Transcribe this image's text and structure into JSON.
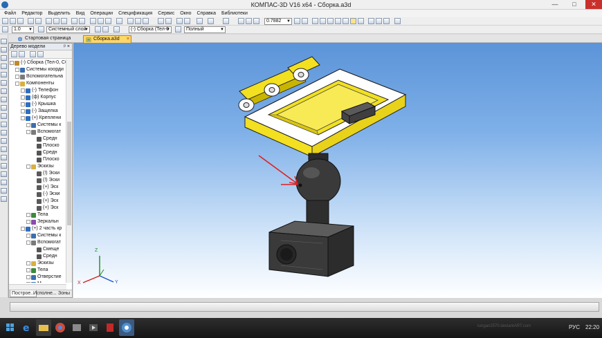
{
  "window": {
    "title": "КОМПАС-3D V16  x64 - Сборка.a3d",
    "min": "—",
    "max": "□",
    "close": "✕"
  },
  "menu": [
    "Файл",
    "Редактор",
    "Выделить",
    "Вид",
    "Операции",
    "Спецификация",
    "Сервис",
    "Окно",
    "Справка",
    "Библиотеки"
  ],
  "toolbar": {
    "scale_combo": "1.0",
    "layer_combo": "Системный слой",
    "assembly_combo": "(-) Сборка (Тел-0",
    "mode_combo": "Полный",
    "zoom_combo": "0.7882"
  },
  "tabs": [
    {
      "label": "Стартовая страница",
      "icon": "globe-icon"
    },
    {
      "label": "Сборка.a3d",
      "icon": "assembly-icon",
      "close": "×"
    }
  ],
  "tree": {
    "header": "Дерево модели",
    "pin": "ᵖ",
    "close": "×",
    "nodes": [
      {
        "label": "(-) Сборка (Тел-0, Сб",
        "indent": 0,
        "icon": "assembly-icon"
      },
      {
        "label": "Системы коорди",
        "indent": 1,
        "icon": "axes-icon"
      },
      {
        "label": "Вспомогательна",
        "indent": 1,
        "icon": "aux-geometry-icon"
      },
      {
        "label": "Компоненты",
        "indent": 1,
        "icon": "folder-icon"
      },
      {
        "label": "(-) Телефон",
        "indent": 2,
        "icon": "part-icon"
      },
      {
        "label": "(ф) Корпус",
        "indent": 2,
        "icon": "part-icon"
      },
      {
        "label": "(-) Крышка",
        "indent": 2,
        "icon": "part-icon"
      },
      {
        "label": "(-) Защелка",
        "indent": 2,
        "icon": "part-icon"
      },
      {
        "label": "(+) Креплени",
        "indent": 2,
        "icon": "part-icon"
      },
      {
        "label": "Системы к",
        "indent": 3,
        "icon": "axes-icon"
      },
      {
        "label": "Вспомогат",
        "indent": 3,
        "icon": "aux-geometry-icon"
      },
      {
        "label": "Средн",
        "indent": 4,
        "icon": "plane-icon"
      },
      {
        "label": "Плоско",
        "indent": 4,
        "icon": "plane-icon"
      },
      {
        "label": "Средн",
        "indent": 4,
        "icon": "plane-icon"
      },
      {
        "label": "Плоско",
        "indent": 4,
        "icon": "plane-icon"
      },
      {
        "label": "Эскизы",
        "indent": 3,
        "icon": "folder-icon"
      },
      {
        "label": "(!) Эски",
        "indent": 4,
        "icon": "sketch-icon"
      },
      {
        "label": "(!) Эски",
        "indent": 4,
        "icon": "sketch-icon"
      },
      {
        "label": "(+) Эск",
        "indent": 4,
        "icon": "sketch-icon"
      },
      {
        "label": "(-) Эски",
        "indent": 4,
        "icon": "sketch-icon"
      },
      {
        "label": "(+) Эск",
        "indent": 4,
        "icon": "sketch-icon"
      },
      {
        "label": "(+) Эск",
        "indent": 4,
        "icon": "sketch-icon"
      },
      {
        "label": "Тела",
        "indent": 3,
        "icon": "body-icon"
      },
      {
        "label": "Зеркальн",
        "indent": 3,
        "icon": "mirror-icon"
      },
      {
        "label": "(+) 2 часть кр",
        "indent": 2,
        "icon": "part-icon"
      },
      {
        "label": "Системы к",
        "indent": 3,
        "icon": "axes-icon"
      },
      {
        "label": "Вспомогат",
        "indent": 3,
        "icon": "aux-geometry-icon"
      },
      {
        "label": "Смеще",
        "indent": 4,
        "icon": "plane-icon"
      },
      {
        "label": "Средн",
        "indent": 4,
        "icon": "plane-icon"
      },
      {
        "label": "Эскизы",
        "indent": 3,
        "icon": "folder-icon"
      },
      {
        "label": "Тела",
        "indent": 3,
        "icon": "body-icon"
      },
      {
        "label": "Отверстие",
        "indent": 3,
        "icon": "hole-icon"
      },
      {
        "label": "М...",
        "indent": 3,
        "icon": "part-icon"
      }
    ],
    "bottom_tabs": [
      "Построе...",
      "Исполне...",
      "Зоны"
    ]
  },
  "viewport": {
    "axis_labels": [
      "Z",
      "X",
      "Y"
    ],
    "watermark": "tungan2570.deviantART.com"
  },
  "taskbar": {
    "apps": [
      "start-icon",
      "ie-icon",
      "explorer-icon",
      "chrome-icon",
      "media-icon",
      "player-icon",
      "pdf-icon",
      "skype-icon",
      "kompas-icon"
    ],
    "lang": "РУС",
    "time": "22:20"
  },
  "colors": {
    "accent": "#ffd766",
    "viewport_top": "#5b94d9",
    "part_yellow": "#f2e021",
    "arrow": "#e02020"
  }
}
